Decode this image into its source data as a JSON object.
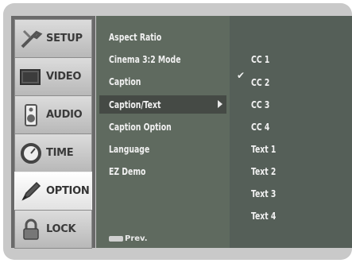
{
  "sidebar": {
    "items": [
      {
        "label": "SETUP",
        "icon": "wrench-icon"
      },
      {
        "label": "VIDEO",
        "icon": "tv-icon"
      },
      {
        "label": "AUDIO",
        "icon": "speaker-icon"
      },
      {
        "label": "TIME",
        "icon": "clock-icon"
      },
      {
        "label": "OPTION",
        "icon": "pencil-icon",
        "active": true
      },
      {
        "label": "LOCK",
        "icon": "padlock-icon"
      }
    ]
  },
  "menu": {
    "items": [
      "Aspect Ratio",
      "Cinema 3:2 Mode",
      "Caption",
      "Caption/Text",
      "Caption Option",
      "Language",
      "EZ Demo"
    ],
    "selected": "Caption/Text",
    "prev_label": "Prev."
  },
  "submenu": {
    "items": [
      "CC 1",
      "CC 2",
      "CC 3",
      "CC 4",
      "Text 1",
      "Text 2",
      "Text 3",
      "Text 4"
    ],
    "checked": "CC 1"
  }
}
